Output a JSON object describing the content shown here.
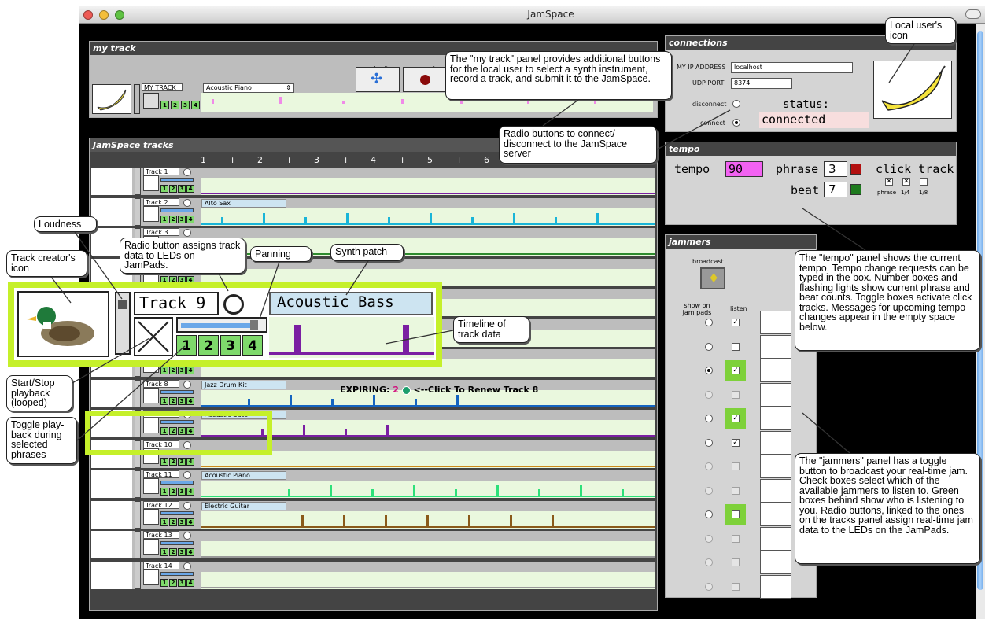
{
  "window": {
    "title": "JamSpace"
  },
  "my_track": {
    "panel_title": "my track",
    "track_name": "MY TRACK",
    "instrument": "Acoustic Piano",
    "submit_label": "submit",
    "record_label": "record",
    "leds": [
      "1",
      "2",
      "3",
      "4"
    ]
  },
  "tracks_panel": {
    "title": "JamSpace tracks",
    "beats": [
      "1",
      "+",
      "2",
      "+",
      "3",
      "+",
      "4",
      "+",
      "5",
      "+",
      "6"
    ],
    "tracks": [
      {
        "name": "Track 1",
        "patch": "",
        "color": "#7b1fa2"
      },
      {
        "name": "Track 2",
        "patch": "Alto Sax",
        "color": "#19b5d8"
      },
      {
        "name": "Track 3",
        "patch": "",
        "color": "#2e8b2e"
      },
      {
        "name": "Track 8",
        "patch": "Jazz Drum Kit",
        "color": "#1565c0"
      },
      {
        "name": "Track 9",
        "patch": "Acoustic Bass",
        "color": "#7b1fa2"
      },
      {
        "name": "Track 10",
        "patch": "",
        "color": "#cc8a1a"
      },
      {
        "name": "Track 11",
        "patch": "Acoustic Piano",
        "color": "#2ee07a"
      },
      {
        "name": "Track 12",
        "patch": "Electric Guitar",
        "color": "#8a5a1a"
      },
      {
        "name": "Track 13",
        "patch": "",
        "color": "#999"
      },
      {
        "name": "Track 14",
        "patch": "",
        "color": "#999"
      }
    ],
    "expiring": {
      "label": "EXPIRING:",
      "count": "2",
      "renew": "<--Click To Renew Track 8"
    }
  },
  "zoom": {
    "track_name": "Track 9",
    "patch": "Acoustic Bass",
    "leds": [
      "1",
      "2",
      "3",
      "4"
    ]
  },
  "connections": {
    "title": "connections",
    "ip_label": "MY IP ADDRESS",
    "ip_value": "localhost",
    "port_label": "UDP PORT",
    "port_value": "8374",
    "disconnect_label": "disconnect",
    "connect_label": "connect",
    "status_label": "status:",
    "status_value": "connected"
  },
  "tempo": {
    "title": "tempo",
    "tempo_label": "tempo",
    "tempo_value": "90",
    "phrase_label": "phrase",
    "phrase_value": "3",
    "beat_label": "beat",
    "beat_value": "7",
    "click_label": "click track",
    "click_opts": [
      "phrase",
      "1/4",
      "1/8"
    ]
  },
  "jammers": {
    "title": "jammers",
    "broadcast": "broadcast",
    "show_on": "show on jam pads",
    "listen": "listen"
  },
  "callouts": {
    "my_track": "The \"my track\" panel provides additional buttons for the local user to select a synth instrument, record a track, and submit it to the JamSpace.",
    "radio": "Radio buttons to connect/ disconnect to the JamSpace server",
    "local_icon": "Local user's icon",
    "tempo": "The \"tempo\" panel shows the current tempo. Tempo change requests can be typed in the box. Number boxes and flashing lights show current phrase and beat counts. Toggle boxes activate click tracks. Messages for upcoming tempo changes appear in the empty space below.",
    "jammers": "The \"jammers\" panel has a toggle button to broadcast your real-time jam. Check boxes select which of the available jammers to listen to. Green boxes behind show who is listening to you. Radio buttons, linked to the ones on the tracks panel assign real-time jam data to the LEDs on the JamPads.",
    "loudness": "Loudness",
    "creator": "Track creator's icon",
    "radio_leds": "Radio button assigns track data to LEDs on JamPads.",
    "panning": "Panning",
    "synth": "Synth patch",
    "timeline": "Timeline of track data",
    "startstop": "Start/Stop playback (looped)",
    "toggle_play": "Toggle play-back during selected phrases"
  }
}
